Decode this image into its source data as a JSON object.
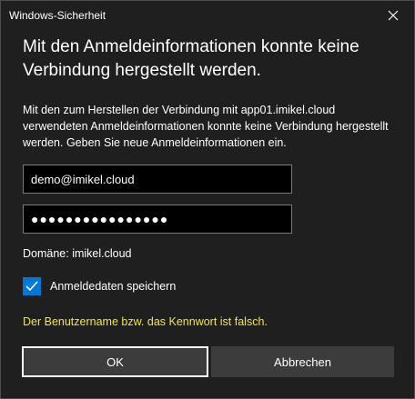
{
  "window": {
    "title": "Windows-Sicherheit"
  },
  "dialog": {
    "heading": "Mit den Anmeldeinformationen konnte keine Verbindung hergestellt werden.",
    "description": "Mit den zum Herstellen der Verbindung mit app01.imikel.cloud verwendeten Anmeldeinformationen konnte keine Verbindung hergestellt werden. Geben Sie neue Anmeldeinformationen ein.",
    "username_value": "demo@imikel.cloud",
    "password_value": "●●●●●●●●●●●●●●●●",
    "domain_text": "Domäne: imikel.cloud",
    "remember_label": "Anmeldedaten speichern",
    "remember_checked": true,
    "error_text": "Der Benutzername bzw. das Kennwort ist falsch.",
    "ok_label": "OK",
    "cancel_label": "Abbrechen"
  },
  "colors": {
    "background": "#1f1f1f",
    "accent": "#0078d7",
    "error": "#f2e63d",
    "button": "#3c3c3c"
  }
}
